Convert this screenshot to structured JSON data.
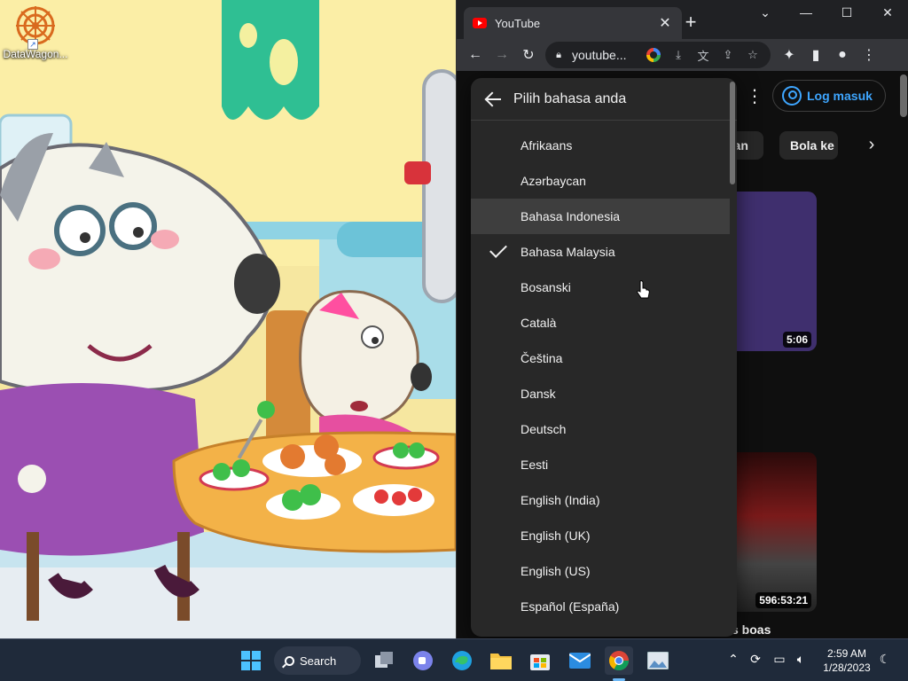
{
  "desktop": {
    "icon_label": "DataWagon..."
  },
  "browser": {
    "tab_title": "YouTube",
    "tab_close": "✕",
    "new_tab": "+",
    "url": "youtube...",
    "win_minimize": "—",
    "win_maximize": "☐",
    "win_close": "✕",
    "win_list": "⌄"
  },
  "youtube": {
    "sign_in_label": "Log masuk",
    "chips": [
      "nan",
      "Bola ke"
    ],
    "video1_duration": "5:06",
    "video2_duration": "596:53:21",
    "video2_title_fragment": "s boas"
  },
  "language_menu": {
    "title": "Pilih bahasa anda",
    "items": [
      {
        "label": "Afrikaans",
        "selected": false,
        "hovered": false
      },
      {
        "label": "Azərbaycan",
        "selected": false,
        "hovered": false
      },
      {
        "label": "Bahasa Indonesia",
        "selected": false,
        "hovered": true
      },
      {
        "label": "Bahasa Malaysia",
        "selected": true,
        "hovered": false
      },
      {
        "label": "Bosanski",
        "selected": false,
        "hovered": false
      },
      {
        "label": "Català",
        "selected": false,
        "hovered": false
      },
      {
        "label": "Čeština",
        "selected": false,
        "hovered": false
      },
      {
        "label": "Dansk",
        "selected": false,
        "hovered": false
      },
      {
        "label": "Deutsch",
        "selected": false,
        "hovered": false
      },
      {
        "label": "Eesti",
        "selected": false,
        "hovered": false
      },
      {
        "label": "English (India)",
        "selected": false,
        "hovered": false
      },
      {
        "label": "English (UK)",
        "selected": false,
        "hovered": false
      },
      {
        "label": "English (US)",
        "selected": false,
        "hovered": false
      },
      {
        "label": "Español (España)",
        "selected": false,
        "hovered": false
      }
    ]
  },
  "taskbar": {
    "search_label": "Search",
    "time": "2:59 AM",
    "date": "1/28/2023"
  },
  "colors": {
    "youtube_red": "#ff0000",
    "link_blue": "#3ea6ff",
    "menu_bg": "#282828",
    "taskbar_bg": "#1f2a3a"
  }
}
